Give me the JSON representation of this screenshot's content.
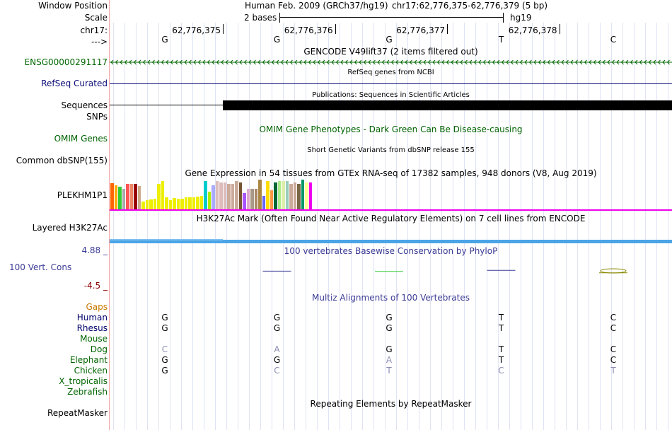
{
  "header": {
    "window_position_label": "Window Position",
    "scale_label": "Scale",
    "chr_label": "chr17:",
    "arrow_label": "--->",
    "assembly": "Human Feb. 2009 (GRCh37/hg19)",
    "position": "chr17:62,776,375-62,776,379 (5 bp)",
    "scale_text": "2 bases",
    "scale_db": "hg19",
    "coordinates": [
      "62,776,375",
      "62,776,376",
      "62,776,377",
      "62,776,378"
    ],
    "bases": [
      "G",
      "G",
      "G",
      "T",
      "C"
    ]
  },
  "tracks": {
    "gencode": {
      "label": "ENSG00000291117",
      "title": "GENCODE V49lift37 (2 items filtered out)"
    },
    "refseq": {
      "label": "RefSeq Curated",
      "title": "RefSeq genes from NCBI"
    },
    "publications": {
      "label": "Sequences",
      "title": "Publications: Sequences in Scientific Articles"
    },
    "snps_label": "SNPs",
    "omim": {
      "label": "OMIM Genes",
      "title": "OMIM Gene Phenotypes - Dark Green Can Be Disease-causing"
    },
    "dbsnp": {
      "label": "Common dbSNP(155)",
      "title": "Short Genetic Variants from dbSNP release 155"
    },
    "gtex": {
      "label": "PLEKHM1P1",
      "title": "Gene Expression in 54 tissues from GTEx RNA-seq of 17382 samples, 948 donors (V8, Aug 2019)",
      "bars": [
        {
          "v": 0.88,
          "c": "#ff6600"
        },
        {
          "v": 0.8,
          "c": "#ffaa00"
        },
        {
          "v": 0.75,
          "c": "#33cc33"
        },
        {
          "v": 0.7,
          "c": "#aaaaaa"
        },
        {
          "v": 0.85,
          "c": "#ff5555"
        },
        {
          "v": 0.85,
          "c": "#ee8866"
        },
        {
          "v": 0.85,
          "c": "#990000"
        },
        {
          "v": 0.78,
          "c": "#ccaa88"
        },
        {
          "v": 0.25,
          "c": "#eeee00"
        },
        {
          "v": 0.3,
          "c": "#eeee00"
        },
        {
          "v": 0.33,
          "c": "#eeee00"
        },
        {
          "v": 0.36,
          "c": "#eeee00"
        },
        {
          "v": 0.85,
          "c": "#eeee00"
        },
        {
          "v": 0.95,
          "c": "#eeee00"
        },
        {
          "v": 0.4,
          "c": "#eeee00"
        },
        {
          "v": 0.3,
          "c": "#eeee00"
        },
        {
          "v": 0.38,
          "c": "#eeee00"
        },
        {
          "v": 0.35,
          "c": "#eeee00"
        },
        {
          "v": 0.35,
          "c": "#eeee00"
        },
        {
          "v": 0.4,
          "c": "#eeee00"
        },
        {
          "v": 0.4,
          "c": "#eeee00"
        },
        {
          "v": 0.4,
          "c": "#eeee00"
        },
        {
          "v": 0.42,
          "c": "#eeee00"
        },
        {
          "v": 0.45,
          "c": "#eeee00"
        },
        {
          "v": 0.95,
          "c": "#00cccc"
        },
        {
          "v": 0.6,
          "c": "#aaee00"
        },
        {
          "v": 0.8,
          "c": "#aaaaff"
        },
        {
          "v": 0.95,
          "c": "#ddbbbb"
        },
        {
          "v": 0.9,
          "c": "#ddbbbb"
        },
        {
          "v": 0.9,
          "c": "#ddbbbb"
        },
        {
          "v": 0.85,
          "c": "#ccaa99"
        },
        {
          "v": 0.85,
          "c": "#ccaa99"
        },
        {
          "v": 0.95,
          "c": "#ccaa99"
        },
        {
          "v": 0.9,
          "c": "#775533"
        },
        {
          "v": 0.55,
          "c": "#aa55ff"
        },
        {
          "v": 0.68,
          "c": "#ddaacc"
        },
        {
          "v": 0.7,
          "c": "#aa9988"
        },
        {
          "v": 0.7,
          "c": "#aa8866"
        },
        {
          "v": 1.0,
          "c": "#aa8844"
        },
        {
          "v": 0.45,
          "c": "#6666ff"
        },
        {
          "v": 0.95,
          "c": "#ffdd00"
        },
        {
          "v": 0.65,
          "c": "#ff9944"
        },
        {
          "v": 0.9,
          "c": "#006633"
        },
        {
          "v": 0.95,
          "c": "#aaee88"
        },
        {
          "v": 0.95,
          "c": "#ddeeaa"
        },
        {
          "v": 0.95,
          "c": "#99ccbb"
        },
        {
          "v": 0.85,
          "c": "#ccaa99"
        },
        {
          "v": 0.9,
          "c": "#ccaa99"
        },
        {
          "v": 0.85,
          "c": "#776644"
        },
        {
          "v": 1.0,
          "c": "#009966"
        },
        {
          "v": 0.9,
          "c": "#ffff99"
        },
        {
          "v": 0.9,
          "c": "#ee00ee"
        }
      ]
    },
    "h3k27ac": {
      "label": "Layered H3K27Ac",
      "title": "H3K27Ac Mark (Often Found Near Active Regulatory Elements) on 7 cell lines from ENCODE"
    },
    "cons": {
      "label": "100 Vert. Cons",
      "max": "4.88 _",
      "min": "-4.5 _",
      "title": "100 vertebrates Basewise Conservation by PhyloP",
      "values": [
        0.0,
        0.2,
        0.15,
        0.35,
        -0.1
      ]
    },
    "multiz": {
      "title": "Multiz Alignments of 100 Vertebrates",
      "gaps_label": "Gaps",
      "species": [
        {
          "name": "Human",
          "bases": [
            "G",
            "G",
            "G",
            "T",
            "C"
          ],
          "dim": [
            false,
            false,
            false,
            false,
            false
          ]
        },
        {
          "name": "Rhesus",
          "bases": [
            "G",
            "G",
            "G",
            "T",
            "C"
          ],
          "dim": [
            false,
            false,
            false,
            false,
            false
          ]
        },
        {
          "name": "Mouse",
          "bases": [
            "",
            "",
            "",
            "",
            ""
          ],
          "dim": [
            false,
            false,
            false,
            false,
            false
          ]
        },
        {
          "name": "Dog",
          "bases": [
            "C",
            "A",
            "G",
            "T",
            "C"
          ],
          "dim": [
            true,
            true,
            false,
            false,
            false
          ]
        },
        {
          "name": "Elephant",
          "bases": [
            "G",
            "G",
            "A",
            "T",
            "C"
          ],
          "dim": [
            false,
            false,
            true,
            false,
            false
          ]
        },
        {
          "name": "Chicken",
          "bases": [
            "G",
            "C",
            "T",
            "C",
            "T"
          ],
          "dim": [
            false,
            true,
            true,
            true,
            true
          ]
        },
        {
          "name": "X_tropicalis",
          "bases": [
            "",
            "",
            "",
            "",
            ""
          ],
          "dim": [
            false,
            false,
            false,
            false,
            false
          ]
        },
        {
          "name": "Zebrafish",
          "bases": [
            "",
            "",
            "",
            "",
            ""
          ],
          "dim": [
            false,
            false,
            false,
            false,
            false
          ]
        }
      ]
    },
    "repeatmasker": {
      "label": "RepeatMasker",
      "title": "Repeating Elements by RepeatMasker"
    }
  },
  "colors": {
    "gencode": "#006600",
    "refseq": "#0c0c78",
    "omim": "#006400",
    "h3k27ac": "#4aa4e6",
    "cons_label": "#3c3c96",
    "cons_min": "#8b0000",
    "gaps": "#c87800",
    "species": "#006400",
    "primate": "#00006e",
    "dim_base": "#8c8cb4",
    "gtex_line": "#ee00ee"
  }
}
